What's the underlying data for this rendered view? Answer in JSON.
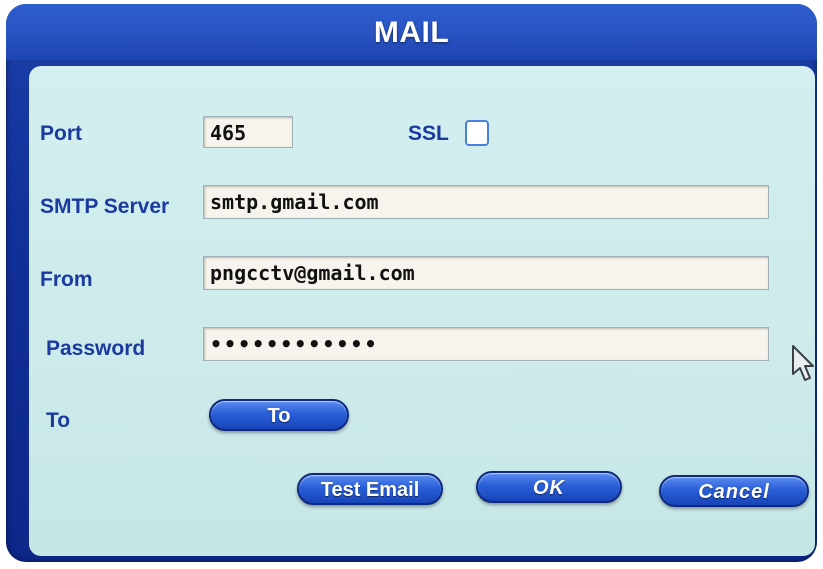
{
  "window": {
    "title": "MAIL"
  },
  "form": {
    "port": {
      "label": "Port",
      "value": "465"
    },
    "ssl": {
      "label": "SSL",
      "checked": false
    },
    "smtp_server": {
      "label": "SMTP Server",
      "value": "smtp.gmail.com"
    },
    "from": {
      "label": "From",
      "value": "pngcctv@gmail.com"
    },
    "password": {
      "label": "Password",
      "value": "••••••••••••"
    },
    "to": {
      "label": "To",
      "button_label": "To"
    }
  },
  "buttons": {
    "test_email": "Test Email",
    "ok": "OK",
    "cancel": "Cancel"
  },
  "colors": {
    "frame": "#1a3fa8",
    "panel": "#cdebea",
    "label": "#1a3aa0",
    "button": "#2a5fd8"
  }
}
